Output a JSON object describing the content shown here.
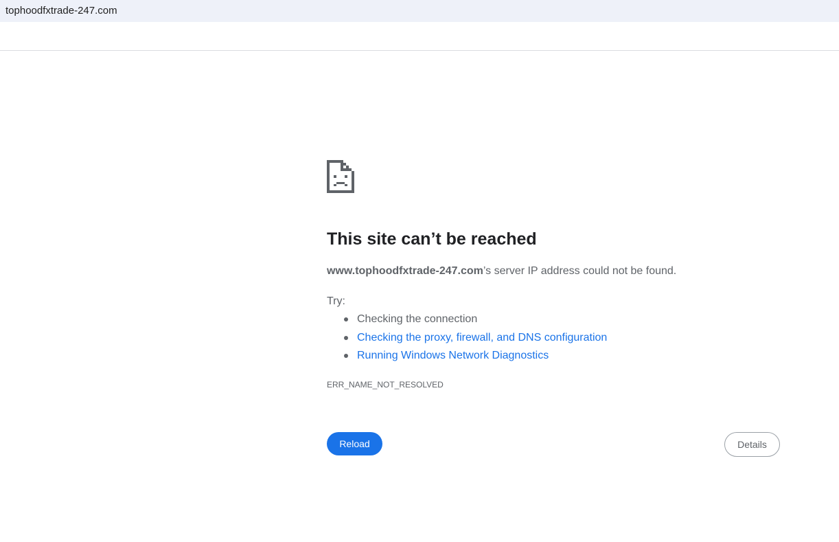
{
  "browser": {
    "address_bar_text": "tophoodfxtrade-247.com"
  },
  "error_page": {
    "icon": "sad-document-icon",
    "title": "This site can’t be reached",
    "host": "www.tophoodfxtrade-247.com",
    "summary_suffix": "’s server IP address could not be found.",
    "try_label": "Try:",
    "suggestions": [
      {
        "label": "Checking the connection",
        "is_link": false
      },
      {
        "label": "Checking the proxy, firewall, and DNS configuration",
        "is_link": true
      },
      {
        "label": "Running Windows Network Diagnostics",
        "is_link": true
      }
    ],
    "error_code": "ERR_NAME_NOT_RESOLVED",
    "reload_label": "Reload",
    "details_label": "Details"
  },
  "colors": {
    "address_bar_bg": "#eef1f9",
    "title_text": "#202124",
    "body_text": "#5f6368",
    "link": "#1a73e8",
    "primary_button": "#1a73e8"
  }
}
